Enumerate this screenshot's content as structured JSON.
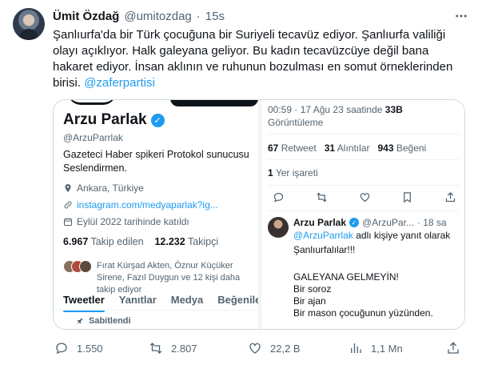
{
  "tweet": {
    "author_name": "Ümit Özdağ",
    "author_handle": "@umitozdag",
    "separator": "·",
    "time": "15s",
    "text_line1": "Şanlıurfa'da bir Türk çocuğuna bir Suriyeli tecavüz ediyor. Şanlıurfa valiliği",
    "text_line2": "olayı açıklıyor. Halk galeyana geliyor. Bu kadın tecavüzcüye değil bana",
    "text_line3": "hakaret ediyor. İnsan aklının ve ruhunun bozulması en somut örneklerinden",
    "text_line4_prefix": "birisi.",
    "text_mention": "@zaferpartisi",
    "more_icon": "more-horizontal-icon"
  },
  "card": {
    "profile": {
      "name": "Arzu Parlak",
      "handle": "@ArzuParrlak",
      "bio_line1": "Gazeteci Haber spikeri Protokol sunucusu",
      "bio_line2": "Seslendirmen.",
      "location": "Ankara, Türkiye",
      "link": "instagram.com/medyaparlak?ig...",
      "joined": "Eylül 2022 tarihinde katıldı",
      "following_count": "6.967",
      "following_label": "Takip edilen",
      "followers_count": "12.232",
      "followers_label": "Takipçi",
      "followed_by": "Fırat Kürşad Akten, Öznur Küçüker Sirene, Fazıl Duygun ve 12 kişi daha takip ediyor",
      "tabs": [
        "Tweetler",
        "Yanıtlar",
        "Medya",
        "Beğeniler"
      ],
      "pinned": "Sabitlendi"
    },
    "detail": {
      "timestamp": "00:59 · 17 Ağu 23 saatinde",
      "views_count": "33B",
      "views_label": "Görüntüleme",
      "retweets_count": "67",
      "retweets_label": "Retweet",
      "quotes_count": "31",
      "quotes_label": "Alıntılar",
      "likes_count": "943",
      "likes_label": "Beğeni",
      "bookmarks_count": "1",
      "bookmarks_label": "Yer işareti"
    },
    "reply": {
      "name": "Arzu Parlak",
      "handle": "@ArzuPar...",
      "time": "· 18 sa",
      "replying_to": "@ArzuParrlak",
      "replying_suffix": "adlı kişiye yanıt olarak",
      "lines": [
        "Şanlıurfalılar!!!",
        "",
        "GALEYANA GELMEYİN!",
        "Bir soroz",
        "Bir ajan",
        "Bir mason çocuğunun yüzünden."
      ]
    }
  },
  "actions": {
    "replies": "1.550",
    "retweets": "2.807",
    "likes": "22,2 B",
    "views": "1,1 Mn"
  }
}
